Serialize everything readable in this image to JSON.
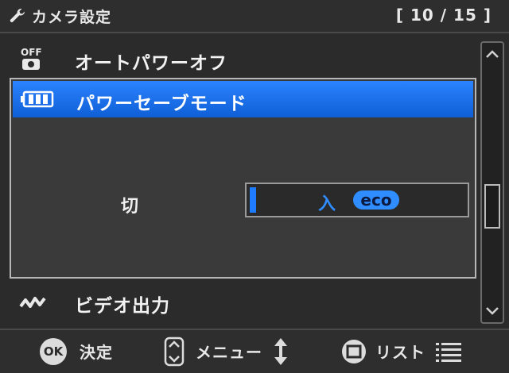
{
  "header": {
    "title": "カメラ設定",
    "counter": "[ 10 / 15 ]",
    "icon": "wrench-icon"
  },
  "menu": {
    "items": [
      {
        "label": "オートパワーオフ",
        "icon": "auto-power-off-icon",
        "icon_text": "OFF"
      },
      {
        "label": "パワーセーブモード",
        "icon": "battery-icon",
        "selected": true
      },
      {
        "label": "ビデオ出力",
        "icon": "video-output-icon"
      }
    ]
  },
  "options": {
    "off_label": "切",
    "on_label": "入",
    "on_badge": "eco"
  },
  "footer": {
    "ok_icon_text": "OK",
    "ok_label": "決定",
    "menu_label": "メニュー",
    "list_label": "リスト"
  },
  "colors": {
    "accent": "#1f7cff",
    "background": "#2b2b2b"
  }
}
